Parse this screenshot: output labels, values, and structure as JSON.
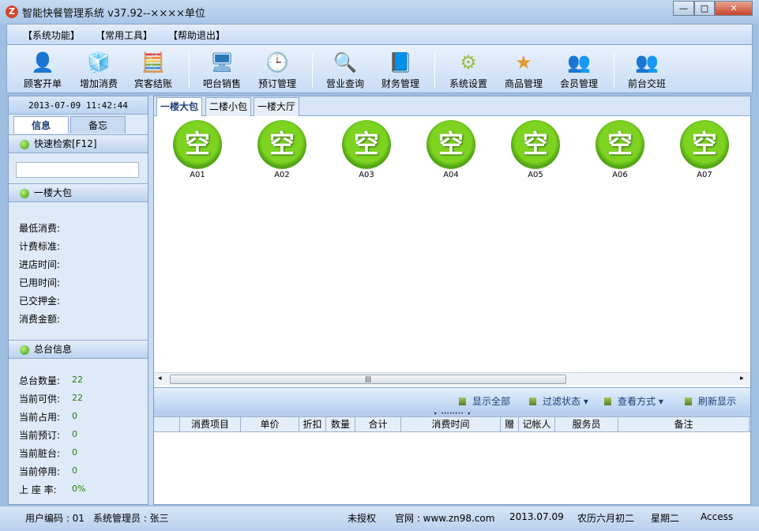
{
  "window": {
    "title": "智能快餐管理系统 v37.92--××××单位",
    "minimize": "—",
    "maximize": "□",
    "close": "✕"
  },
  "menu": [
    "【系统功能】",
    "【常用工具】",
    "【帮助退出】"
  ],
  "toolbar": [
    {
      "label": "顾客开单",
      "icon": "customer-icon",
      "glyph": "👤"
    },
    {
      "label": "增加消费",
      "icon": "cubes-icon",
      "glyph": "🧊"
    },
    {
      "label": "宾客结账",
      "icon": "calculator-icon",
      "glyph": "🧮"
    },
    {
      "label": "吧台销售",
      "icon": "monitor-icon",
      "glyph": "🖥"
    },
    {
      "label": "预订管理",
      "icon": "clock-calendar-icon",
      "glyph": "🕒"
    },
    {
      "label": "营业查询",
      "icon": "magnifier-icon",
      "glyph": "🔍"
    },
    {
      "label": "财务管理",
      "icon": "notebook-pencil-icon",
      "glyph": "📘"
    },
    {
      "label": "系统设置",
      "icon": "gear-icon",
      "glyph": "⚙"
    },
    {
      "label": "商品管理",
      "icon": "star-icon",
      "glyph": "★"
    },
    {
      "label": "会员管理",
      "icon": "users-icon",
      "glyph": "👥"
    },
    {
      "label": "前台交班",
      "icon": "shift-handover-icon",
      "glyph": "👥"
    }
  ],
  "left": {
    "datetime": "2013-07-09 11:42:44",
    "tabs": [
      "信息",
      "备忘"
    ],
    "search_header": "快速检索[F12]",
    "search_value": "",
    "room_header": "一楼大包",
    "room_fields": [
      "最低消费:",
      "计费标准:",
      "进店时间:",
      "已用时间:",
      "已交押金:",
      "消费金额:"
    ],
    "summary_header": "总台信息",
    "summary": [
      {
        "label": "总台数量:",
        "value": "22"
      },
      {
        "label": "当前可供:",
        "value": "22"
      },
      {
        "label": "当前占用:",
        "value": "0"
      },
      {
        "label": "当前预订:",
        "value": "0"
      },
      {
        "label": "当前脏台:",
        "value": "0"
      },
      {
        "label": "当前停用:",
        "value": "0"
      },
      {
        "label": "上 座 率:",
        "value": "0%"
      }
    ]
  },
  "area_tabs": [
    "一楼大包",
    "二楼小包",
    "一楼大厅"
  ],
  "rooms": [
    {
      "status": "空",
      "name": "A01"
    },
    {
      "status": "空",
      "name": "A02"
    },
    {
      "status": "空",
      "name": "A03"
    },
    {
      "status": "空",
      "name": "A04"
    },
    {
      "status": "空",
      "name": "A05"
    },
    {
      "status": "空",
      "name": "A06"
    },
    {
      "status": "空",
      "name": "A07"
    }
  ],
  "bottom_toolbar": {
    "show_all": "显示全部",
    "filter": "过滤状态 ▾",
    "view": "查看方式 ▾",
    "refresh": "刷新显示"
  },
  "table_columns": [
    "",
    "消费项目",
    "单价",
    "折扣",
    "数量",
    "合计",
    "消费时间",
    "赠",
    "记帐人",
    "服务员",
    "备注"
  ],
  "status": {
    "user": "用户编码 : 01",
    "role": "系统管理员 : 张三",
    "license": "未授权",
    "site": "官网 : www.zn98.com",
    "date": "2013.07.09",
    "lunar": "农历六月初二",
    "weekday": "星期二",
    "db": "Access"
  }
}
